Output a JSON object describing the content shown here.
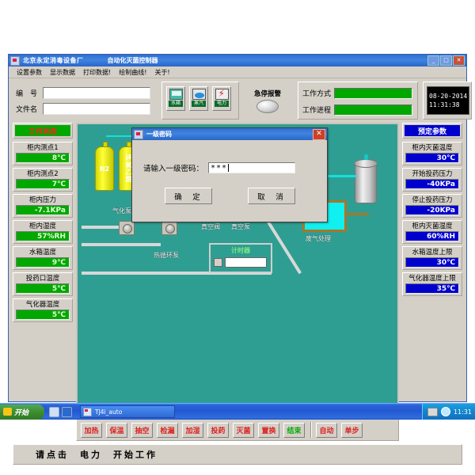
{
  "window": {
    "title": "北京永定消毒设备厂",
    "subtitle": "自动化灭菌控制器",
    "minimize_label": "_",
    "maximize_label": "□",
    "close_label": "✕"
  },
  "menu": {
    "items": [
      {
        "label": "设置参数"
      },
      {
        "label": "显示数据"
      },
      {
        "label": "打印数据!"
      },
      {
        "label": "绘制曲线!"
      },
      {
        "label": "关于!"
      }
    ]
  },
  "form": {
    "number_label": "编　号",
    "number_value": "",
    "filename_label": "文件名",
    "filename_value": ""
  },
  "sources": {
    "buttons": [
      {
        "label": "水箱",
        "icon": "water-tank-icon"
      },
      {
        "label": "蒸汽",
        "icon": "steam-icon"
      },
      {
        "label": "电力",
        "icon": "power-bolt-icon"
      }
    ]
  },
  "emergency": {
    "label": "急停报警",
    "indicator": "emergency-stop-led"
  },
  "mode_panel": {
    "work_mode_label": "工作方式",
    "work_mode_value": "",
    "work_progress_label": "工作进程",
    "work_progress_value": ""
  },
  "clock": {
    "date": "08-20-2014",
    "time": "11:31:38"
  },
  "left_panel": {
    "header": "工作状态",
    "items": [
      {
        "title": "柜内测点1",
        "value": "8℃"
      },
      {
        "title": "柜内测点2",
        "value": "7℃"
      },
      {
        "title": "柜内压力",
        "value": "-7.1KPa"
      },
      {
        "title": "柜内湿度",
        "value": "57%RH"
      },
      {
        "title": "水箱温度",
        "value": "9℃"
      },
      {
        "title": "投药口温度",
        "value": "5℃"
      },
      {
        "title": "气化器温度",
        "value": "5℃"
      }
    ]
  },
  "right_panel": {
    "header": "预定参数",
    "items": [
      {
        "title": "柜内灭菌温度",
        "value": "30℃"
      },
      {
        "title": "开始投药压力",
        "value": "-40KPa"
      },
      {
        "title": "停止投药压力",
        "value": "-20KPa"
      },
      {
        "title": "柜内灭菌湿度",
        "value": "60%RH"
      },
      {
        "title": "水箱温度上限",
        "value": "30℃"
      },
      {
        "title": "气化器温度上限",
        "value": "35℃"
      }
    ]
  },
  "mimic": {
    "cylinder_n2": "N2",
    "cylinder_eo": "环氧乙烷",
    "label_vaporizer_pump": "气化泵",
    "label_circulation_pump": "热循环泵",
    "label_vacuum_valve": "真空阀",
    "label_vacuum_pump": "真空泵",
    "label_exhaust": "废气处理",
    "timer_label": "计时器",
    "timer_value": "",
    "timer_checkbox": false
  },
  "actions": {
    "steps": [
      {
        "label": "加热",
        "color": "red"
      },
      {
        "label": "保温",
        "color": "red"
      },
      {
        "label": "抽空",
        "color": "red"
      },
      {
        "label": "检漏",
        "color": "red"
      },
      {
        "label": "加湿",
        "color": "red"
      },
      {
        "label": "投药",
        "color": "red"
      },
      {
        "label": "灭菌",
        "color": "red"
      },
      {
        "label": "置换",
        "color": "red"
      },
      {
        "label": "结束",
        "color": "green"
      }
    ],
    "modes": [
      {
        "label": "自动"
      },
      {
        "label": "单步"
      }
    ]
  },
  "status_bar": {
    "text": "请点击　电力　开始工作"
  },
  "dialog": {
    "title": "一级密码",
    "close_label": "✕",
    "prompt": "请输入一级密码：",
    "password_value": "***",
    "ok_label": "确　定",
    "cancel_label": "取　消"
  },
  "taskbar": {
    "start_label": "开始",
    "tasks": [
      {
        "label": "TJ4i_auto"
      }
    ],
    "clock": "11:31"
  },
  "colors": {
    "face": "#d4d0c8",
    "title_blue": "#2f6fd0",
    "led_green": "#00a800",
    "param_blue": "#0000cd",
    "mimic_teal": "#2f9e92",
    "action_red": "#dd2222",
    "action_green": "#00aa00"
  }
}
